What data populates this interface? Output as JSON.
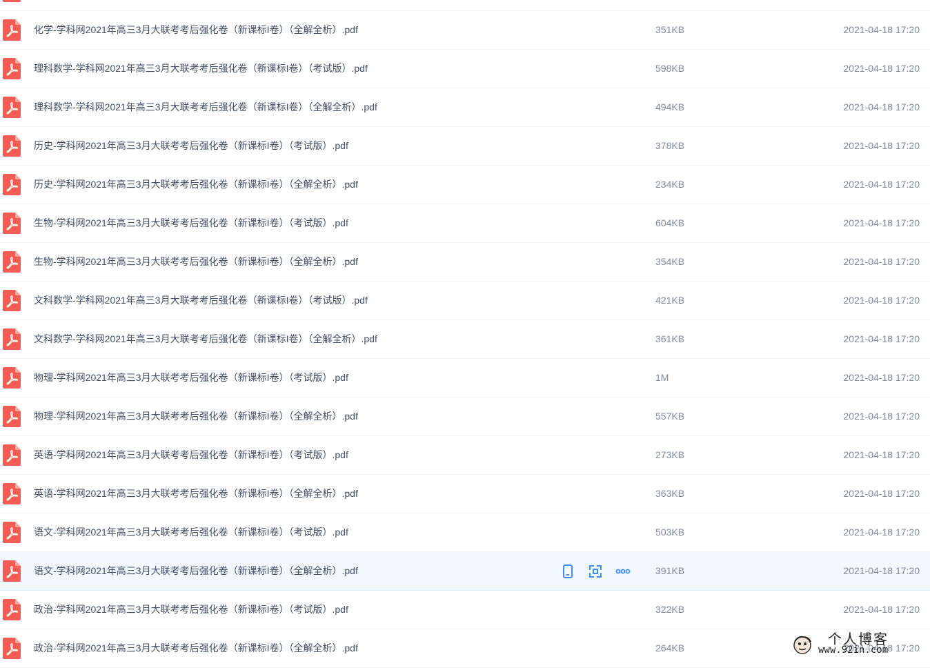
{
  "files": [
    {
      "name": "",
      "size": "",
      "time": ""
    },
    {
      "name": "化学-学科网2021年高三3月大联考考后强化卷（新课标I卷）（全解全析）.pdf",
      "size": "351KB",
      "time": "2021-04-18 17:20"
    },
    {
      "name": "理科数学-学科网2021年高三3月大联考考后强化卷（新课标I卷）（考试版）.pdf",
      "size": "598KB",
      "time": "2021-04-18 17:20"
    },
    {
      "name": "理科数学-学科网2021年高三3月大联考考后强化卷（新课标I卷）（全解全析）.pdf",
      "size": "494KB",
      "time": "2021-04-18 17:20"
    },
    {
      "name": "历史-学科网2021年高三3月大联考考后强化卷（新课标I卷）（考试版）.pdf",
      "size": "378KB",
      "time": "2021-04-18 17:20"
    },
    {
      "name": "历史-学科网2021年高三3月大联考考后强化卷（新课标I卷）（全解全析）.pdf",
      "size": "234KB",
      "time": "2021-04-18 17:20"
    },
    {
      "name": "生物-学科网2021年高三3月大联考考后强化卷（新课标I卷）（考试版）.pdf",
      "size": "604KB",
      "time": "2021-04-18 17:20"
    },
    {
      "name": "生物-学科网2021年高三3月大联考考后强化卷（新课标I卷）（全解全析）.pdf",
      "size": "354KB",
      "time": "2021-04-18 17:20"
    },
    {
      "name": "文科数学-学科网2021年高三3月大联考考后强化卷（新课标I卷）（考试版）.pdf",
      "size": "421KB",
      "time": "2021-04-18 17:20"
    },
    {
      "name": "文科数学-学科网2021年高三3月大联考考后强化卷（新课标I卷）（全解全析）.pdf",
      "size": "361KB",
      "time": "2021-04-18 17:20"
    },
    {
      "name": "物理-学科网2021年高三3月大联考考后强化卷（新课标I卷）（考试版）.pdf",
      "size": "1M",
      "time": "2021-04-18 17:20"
    },
    {
      "name": "物理-学科网2021年高三3月大联考考后强化卷（新课标I卷）（全解全析）.pdf",
      "size": "557KB",
      "time": "2021-04-18 17:20"
    },
    {
      "name": "英语-学科网2021年高三3月大联考考后强化卷（新课标I卷）（考试版）.pdf",
      "size": "273KB",
      "time": "2021-04-18 17:20"
    },
    {
      "name": "英语-学科网2021年高三3月大联考考后强化卷（新课标I卷）（全解全析）.pdf",
      "size": "363KB",
      "time": "2021-04-18 17:20"
    },
    {
      "name": "语文-学科网2021年高三3月大联考考后强化卷（新课标I卷）（考试版）.pdf",
      "size": "503KB",
      "time": "2021-04-18 17:20"
    },
    {
      "name": "语文-学科网2021年高三3月大联考考后强化卷（新课标I卷）（全解全析）.pdf",
      "size": "391KB",
      "time": "2021-04-18 17:20",
      "hover": true
    },
    {
      "name": "政治-学科网2021年高三3月大联考考后强化卷（新课标I卷）（考试版）.pdf",
      "size": "322KB",
      "time": "2021-04-18 17:20"
    },
    {
      "name": "政治-学科网2021年高三3月大联考考后强化卷（新课标I卷）（全解全析）.pdf",
      "size": "264KB",
      "time": "2021-04-18 17:20"
    }
  ],
  "row_actions": [
    "phone-icon",
    "share-icon",
    "more-icon"
  ],
  "colors": {
    "pdf_icon": "#f25c54",
    "action_icon": "#3b8cff",
    "hover_row": "#f1f8fe"
  },
  "watermark": {
    "title": "个人博客",
    "url": "www.92in.com"
  }
}
